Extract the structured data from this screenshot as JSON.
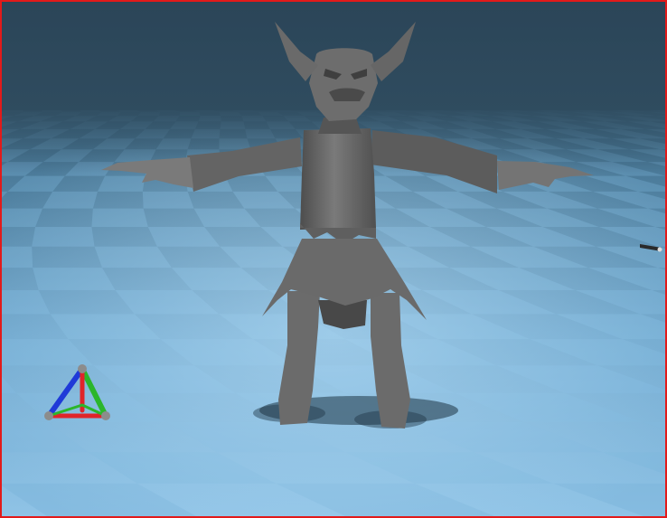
{
  "viewport": {
    "border_color": "#e21a1a",
    "sky_color_top": "#2b4558",
    "sky_color_bottom": "#3f6579",
    "floor_color_far": "#3e6a86",
    "floor_color_near": "#8fc3e6",
    "floor_tile_dark": "#4f84a6",
    "floor_tile_light": "#7db6dc"
  },
  "model": {
    "name": "",
    "color": "#6f6f6f",
    "shadow_color": "#1e3544"
  },
  "gizmo": {
    "icon": "axis-gizmo-icon",
    "x_color": "#e0242a",
    "y_color": "#2bb62b",
    "z_color": "#1f3ad8",
    "handle_color": "#8c8c8c"
  },
  "light_marker": {
    "icon": "light-marker-icon"
  }
}
